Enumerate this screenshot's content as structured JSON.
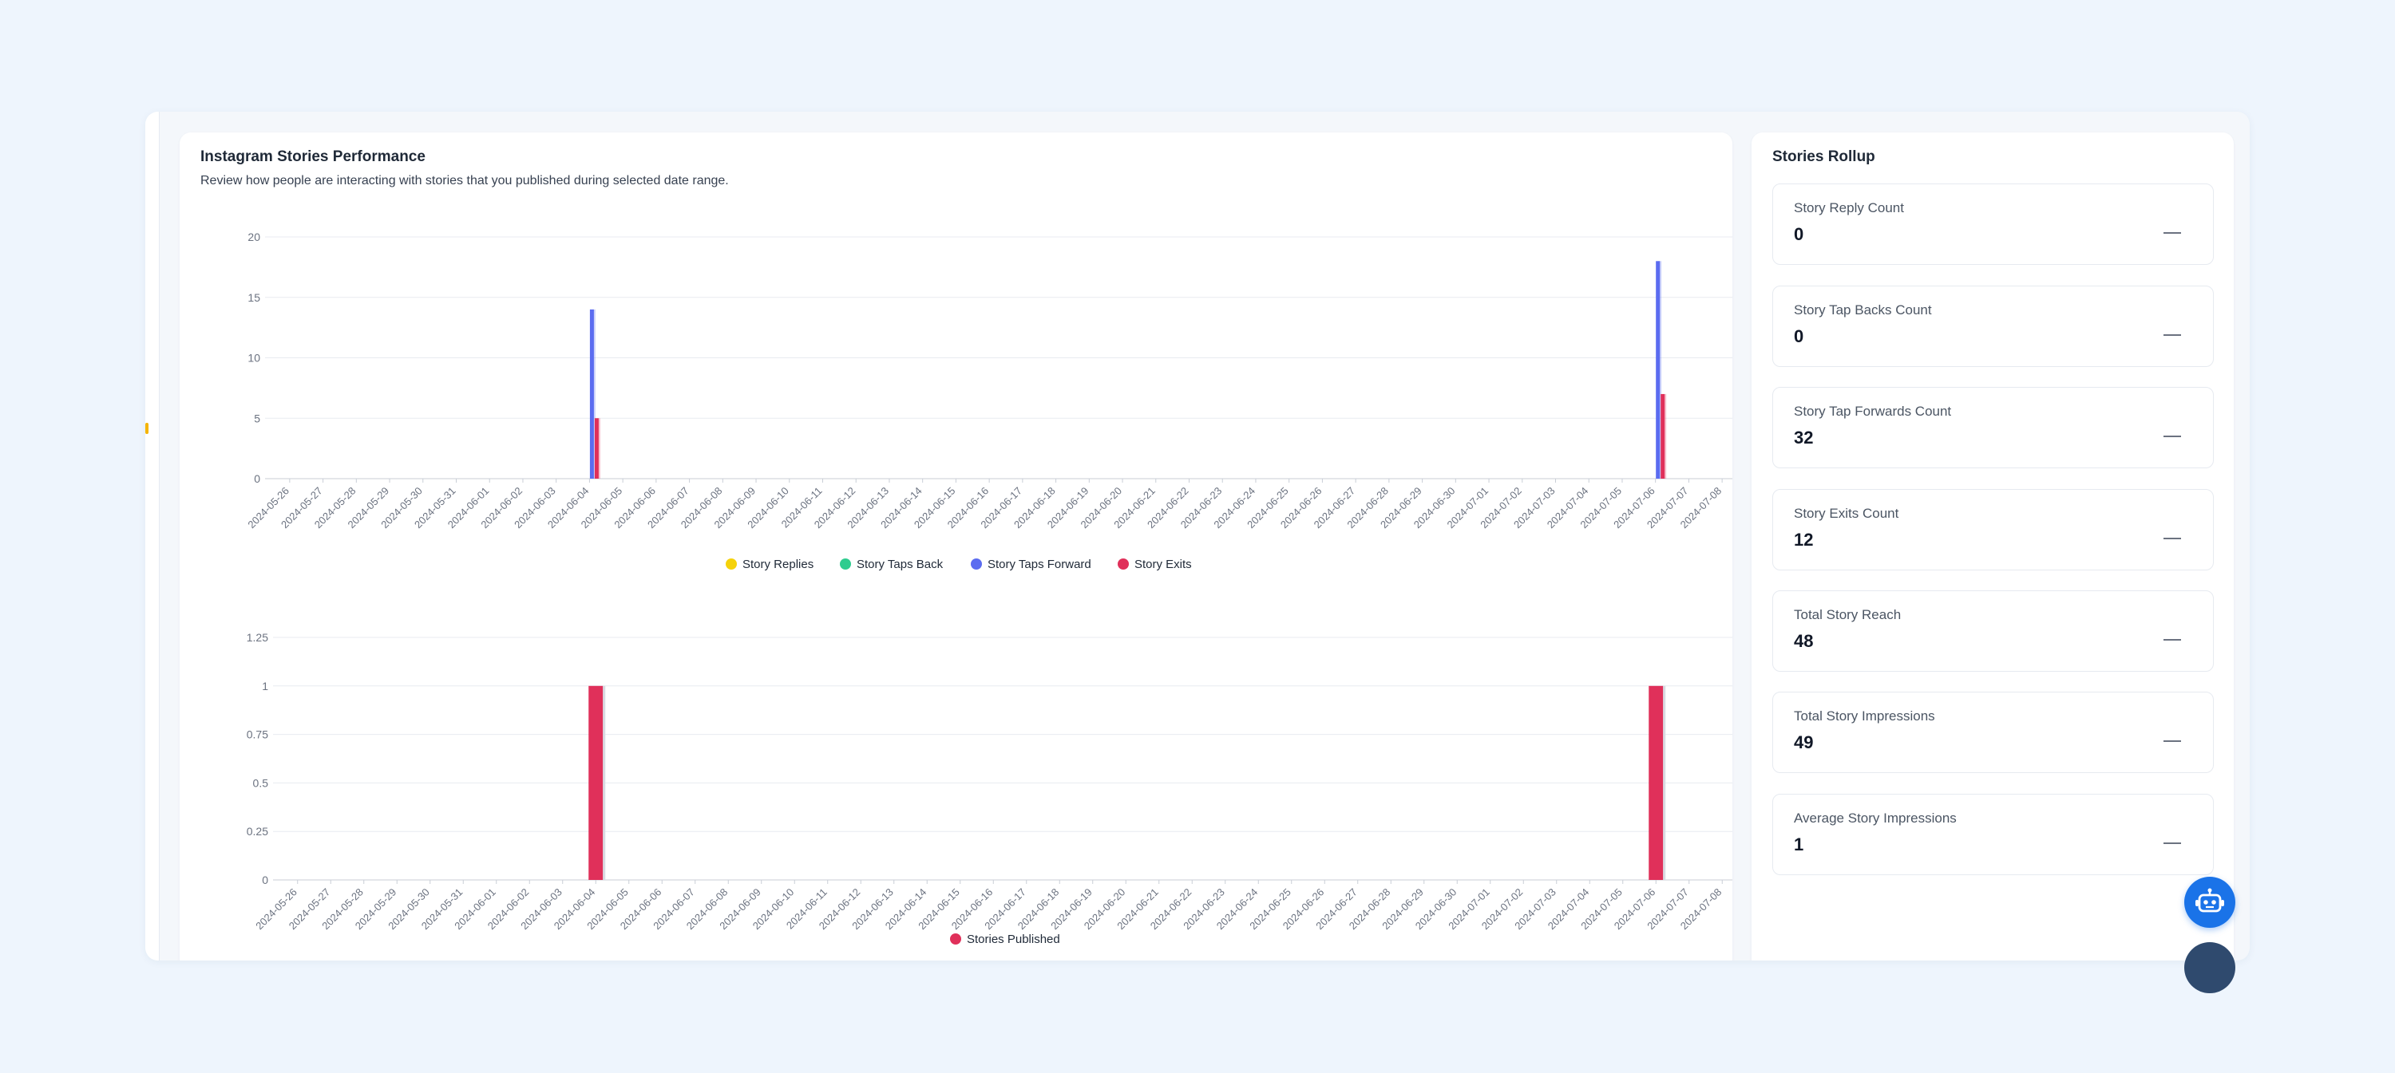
{
  "performance": {
    "title": "Instagram Stories Performance",
    "subtitle": "Review how people are interacting with stories that you published during selected date range."
  },
  "rollup": {
    "title": "Stories Rollup",
    "metrics": [
      {
        "label": "Story Reply Count",
        "value": "0"
      },
      {
        "label": "Story Tap Backs Count",
        "value": "0"
      },
      {
        "label": "Story Tap Forwards Count",
        "value": "32"
      },
      {
        "label": "Story Exits Count",
        "value": "12"
      },
      {
        "label": "Total Story Reach",
        "value": "48"
      },
      {
        "label": "Total Story Impressions",
        "value": "49"
      },
      {
        "label": "Average Story Impressions",
        "value": "1"
      }
    ]
  },
  "icons": {
    "assistant": "robot-icon",
    "chat": "chat-icon"
  },
  "colors": {
    "story_replies": "#f5d20b",
    "story_taps_back": "#2ecc8f",
    "story_taps_forward": "#5b6cf0",
    "story_exits": "#e0305a",
    "stories_published": "#e0305a",
    "assistant_button": "#1a73e8"
  },
  "chart_data": [
    {
      "type": "bar",
      "categories": [
        "2024-05-26",
        "2024-05-27",
        "2024-05-28",
        "2024-05-29",
        "2024-05-30",
        "2024-05-31",
        "2024-06-01",
        "2024-06-02",
        "2024-06-03",
        "2024-06-04",
        "2024-06-05",
        "2024-06-06",
        "2024-06-07",
        "2024-06-08",
        "2024-06-09",
        "2024-06-10",
        "2024-06-11",
        "2024-06-12",
        "2024-06-13",
        "2024-06-14",
        "2024-06-15",
        "2024-06-16",
        "2024-06-17",
        "2024-06-18",
        "2024-06-19",
        "2024-06-20",
        "2024-06-21",
        "2024-06-22",
        "2024-06-23",
        "2024-06-24",
        "2024-06-25",
        "2024-06-26",
        "2024-06-27",
        "2024-06-28",
        "2024-06-29",
        "2024-06-30",
        "2024-07-01",
        "2024-07-02",
        "2024-07-03",
        "2024-07-04",
        "2024-07-05",
        "2024-07-06",
        "2024-07-07",
        "2024-07-08"
      ],
      "series": [
        {
          "name": "Story Replies",
          "points": {}
        },
        {
          "name": "Story Taps Back",
          "points": {}
        },
        {
          "name": "Story Taps Forward",
          "points": {
            "2024-06-04": 14,
            "2024-07-06": 18
          }
        },
        {
          "name": "Story Exits",
          "points": {
            "2024-06-04": 5,
            "2024-07-06": 7
          }
        }
      ],
      "yticks": [
        "0",
        "5",
        "10",
        "15",
        "20"
      ],
      "ylim": [
        0,
        20
      ],
      "legend": "bottom",
      "grid": true
    },
    {
      "type": "bar",
      "categories": [
        "2024-05-26",
        "2024-05-27",
        "2024-05-28",
        "2024-05-29",
        "2024-05-30",
        "2024-05-31",
        "2024-06-01",
        "2024-06-02",
        "2024-06-03",
        "2024-06-04",
        "2024-06-05",
        "2024-06-06",
        "2024-06-07",
        "2024-06-08",
        "2024-06-09",
        "2024-06-10",
        "2024-06-11",
        "2024-06-12",
        "2024-06-13",
        "2024-06-14",
        "2024-06-15",
        "2024-06-16",
        "2024-06-17",
        "2024-06-18",
        "2024-06-19",
        "2024-06-20",
        "2024-06-21",
        "2024-06-22",
        "2024-06-23",
        "2024-06-24",
        "2024-06-25",
        "2024-06-26",
        "2024-06-27",
        "2024-06-28",
        "2024-06-29",
        "2024-06-30",
        "2024-07-01",
        "2024-07-02",
        "2024-07-03",
        "2024-07-04",
        "2024-07-05",
        "2024-07-06",
        "2024-07-07",
        "2024-07-08"
      ],
      "series": [
        {
          "name": "Stories Published",
          "points": {
            "2024-06-04": 1,
            "2024-07-06": 1
          }
        }
      ],
      "yticks": [
        "0",
        "0.25",
        "0.5",
        "0.75",
        "1",
        "1.25"
      ],
      "ylim": [
        0,
        1.25
      ],
      "legend": "bottom",
      "grid": true
    }
  ]
}
